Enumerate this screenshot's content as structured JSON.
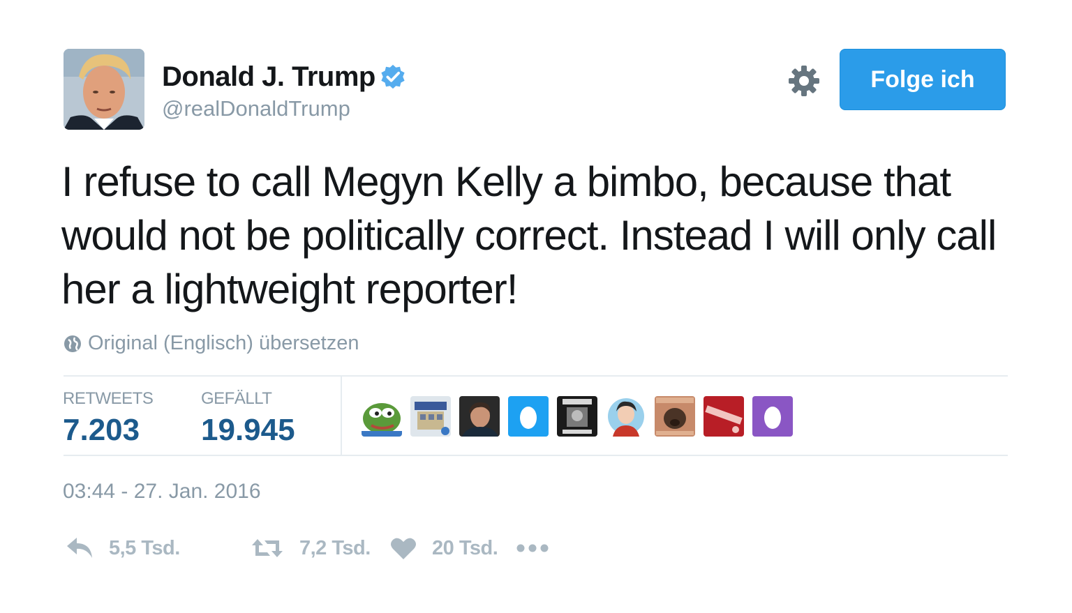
{
  "user": {
    "display_name": "Donald J. Trump",
    "handle": "@realDonaldTrump",
    "verified": true
  },
  "header": {
    "follow_label": "Folge ich"
  },
  "tweet": {
    "text": "I refuse to call Megyn Kelly a bimbo, because that would not be politically correct. Instead I will only call her a lightweight reporter!",
    "translate_label": "Original (Englisch) übersetzen",
    "timestamp": "03:44 - 27. Jan. 2016"
  },
  "stats": {
    "retweets_label": "RETWEETS",
    "retweets_value": "7.203",
    "likes_label": "GEFÄLLT",
    "likes_value": "19.945"
  },
  "likers": [
    {
      "icon": "pepe-avatar"
    },
    {
      "icon": "building-avatar"
    },
    {
      "icon": "man-portrait-avatar"
    },
    {
      "icon": "egg-avatar-blue"
    },
    {
      "icon": "poster-avatar"
    },
    {
      "icon": "cartoon-avatar"
    },
    {
      "icon": "brown-dog-avatar"
    },
    {
      "icon": "bang-avatar"
    },
    {
      "icon": "egg-avatar-purple"
    }
  ],
  "actions": {
    "reply_count": "5,5 Tsd.",
    "retweet_count": "7,2 Tsd.",
    "like_count": "20 Tsd."
  },
  "colors": {
    "follow_button": "#2b9ce9",
    "verified_badge": "#55acee",
    "stat_value": "#1c5a8c",
    "muted_text": "#8899a6",
    "action_icon": "#aab8c2"
  }
}
